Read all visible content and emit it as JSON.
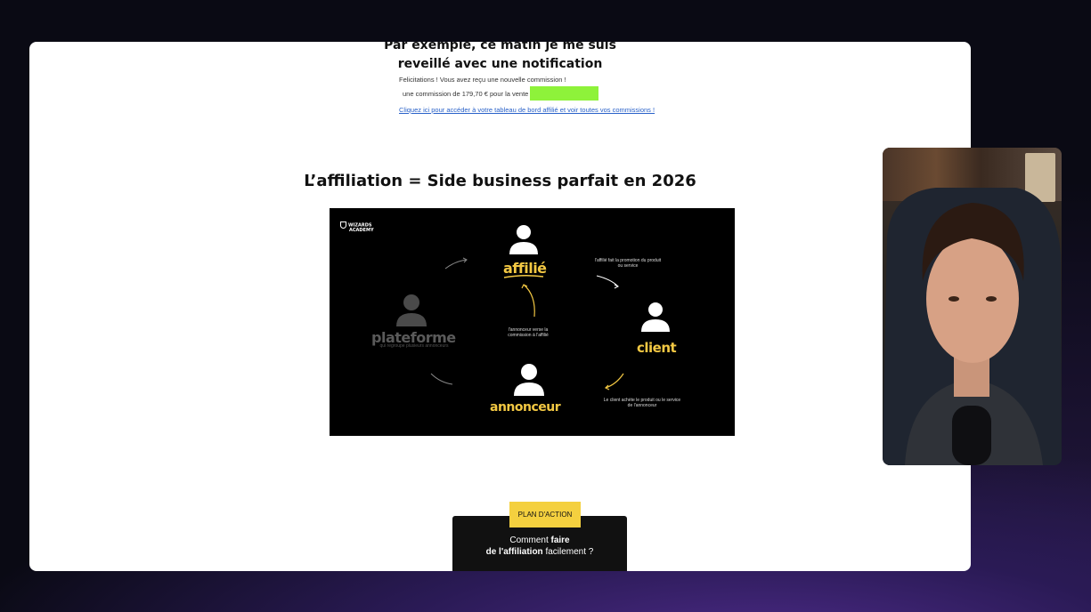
{
  "intro": {
    "line1": "Par exemple, ce matin je me suis",
    "line2": "reveillé avec une notification"
  },
  "notification": {
    "line1": "Felicitations ! Vous avez reçu une nouvelle commission !",
    "line2": "une commission de 179,70 € pour la vente",
    "link": "Cliquez ici pour accéder à votre tableau de bord affilié et voir toutes vos commissions !"
  },
  "section_title": "L’affiliation = Side business parfait en 2026",
  "diagram": {
    "logo": {
      "line1": "WIZARDS",
      "line2": "ACADEMY"
    },
    "nodes": {
      "affilie": "affilié",
      "client": "client",
      "annonceur": "annonceur",
      "plateforme": "plateforme",
      "plateforme_sub": "qui regroupe plusieurs annonceurs"
    },
    "notes": {
      "affilie_to_client": "l'affilié fait la promotion du produit ou service",
      "client_to_annonceur": "Le client achète le produit ou le service de l'annonceur",
      "annonceur_to_affilie": "l'annonceur verse la commission à l'affilié"
    },
    "accent_color": "#f3c843"
  },
  "plan": {
    "tag": "PLAN D'ACTION",
    "text_pre": "Comment ",
    "text_bold1": "faire",
    "text_bold2": "de l'affiliation",
    "text_post": " facilement ?"
  }
}
